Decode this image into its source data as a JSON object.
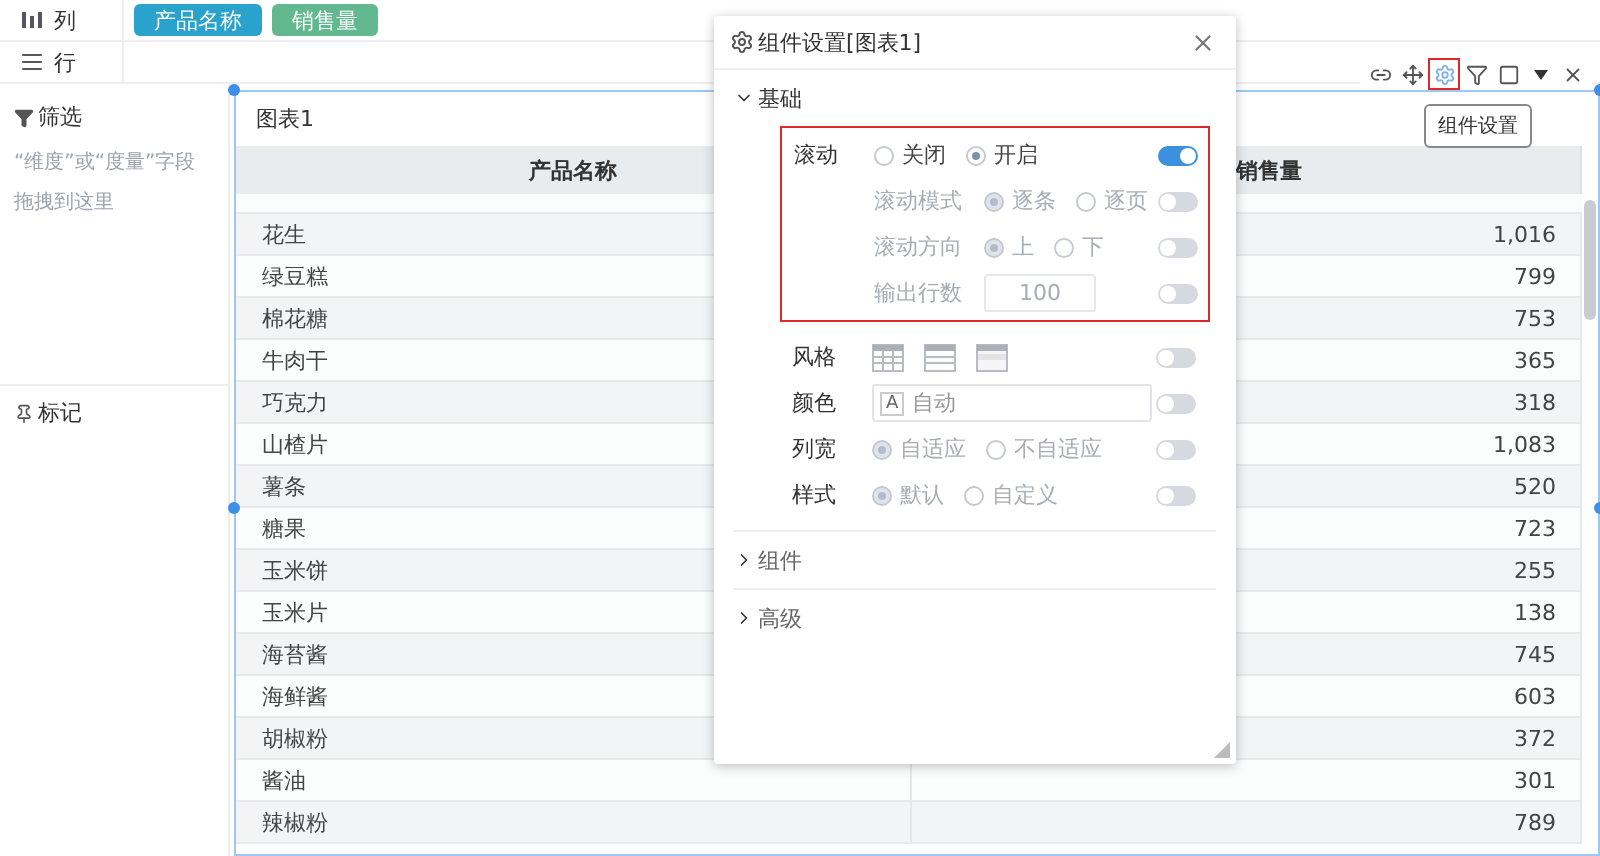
{
  "columns_shelf": {
    "label": "列",
    "fields": [
      {
        "label": "产品名称",
        "color": "#2aa3cc"
      },
      {
        "label": "销售量",
        "color": "#62b88f"
      }
    ]
  },
  "rows_shelf": {
    "label": "行"
  },
  "filter_panel": {
    "title": "筛选",
    "hint": "“维度”或“度量”字段拖拽到这里"
  },
  "marks_panel": {
    "title": "标记"
  },
  "chart": {
    "title": "图表1",
    "columns": [
      "产品名称",
      "销售量"
    ],
    "rows": [
      [
        "花生",
        "1,016"
      ],
      [
        "绿豆糕",
        "799"
      ],
      [
        "棉花糖",
        "753"
      ],
      [
        "牛肉干",
        "365"
      ],
      [
        "巧克力",
        "318"
      ],
      [
        "山楂片",
        "1,083"
      ],
      [
        "薯条",
        "520"
      ],
      [
        "糖果",
        "723"
      ],
      [
        "玉米饼",
        "255"
      ],
      [
        "玉米片",
        "138"
      ],
      [
        "海苔酱",
        "745"
      ],
      [
        "海鲜酱",
        "603"
      ],
      [
        "胡椒粉",
        "372"
      ],
      [
        "酱油",
        "301"
      ],
      [
        "辣椒粉",
        "789"
      ]
    ]
  },
  "toolbar": [
    {
      "kind": "link",
      "highlighted": false
    },
    {
      "kind": "move",
      "highlighted": false
    },
    {
      "kind": "settings",
      "highlighted": true
    },
    {
      "kind": "filter",
      "highlighted": false
    },
    {
      "kind": "maximize",
      "highlighted": false
    },
    {
      "kind": "menu",
      "highlighted": false
    },
    {
      "kind": "close",
      "highlighted": false
    }
  ],
  "tooltip": "组件设置",
  "dialog": {
    "title": "组件设置[图表1]",
    "sections": [
      {
        "title": "基础",
        "expanded": true
      },
      {
        "title": "组件",
        "expanded": false
      },
      {
        "title": "高级",
        "expanded": false
      }
    ],
    "scroll_group": {
      "highlighted": true,
      "rows": [
        {
          "kind": "radio",
          "label": "滚动",
          "nested": false,
          "disabled": false,
          "on": true,
          "options": [
            {
              "label": "关闭",
              "selected": false
            },
            {
              "label": "开启",
              "selected": true
            }
          ]
        },
        {
          "kind": "radio",
          "label": "滚动模式",
          "nested": true,
          "disabled": true,
          "on": false,
          "options": [
            {
              "label": "逐条",
              "selected": true
            },
            {
              "label": "逐页",
              "selected": false
            }
          ]
        },
        {
          "kind": "radio",
          "label": "滚动方向",
          "nested": true,
          "disabled": true,
          "on": false,
          "options": [
            {
              "label": "上",
              "selected": true
            },
            {
              "label": "下",
              "selected": false
            }
          ]
        },
        {
          "kind": "number",
          "label": "输出行数",
          "nested": true,
          "disabled": true,
          "on": false,
          "value": "100"
        }
      ]
    },
    "rows": [
      {
        "kind": "styles",
        "label": "风格",
        "on": false,
        "styles": [
          {
            "kind": "grid"
          },
          {
            "kind": "rows"
          },
          {
            "kind": "header"
          }
        ]
      },
      {
        "kind": "color",
        "label": "颜色",
        "on": false,
        "badge": "A",
        "value": "自动"
      },
      {
        "kind": "radio",
        "label": "列宽",
        "on": false,
        "disabled": true,
        "options": [
          {
            "label": "自适应",
            "selected": true
          },
          {
            "label": "不自适应",
            "selected": false
          }
        ]
      },
      {
        "kind": "radio",
        "label": "样式",
        "on": false,
        "disabled": true,
        "options": [
          {
            "label": "默认",
            "selected": true
          },
          {
            "label": "自定义",
            "selected": false
          }
        ]
      }
    ]
  }
}
